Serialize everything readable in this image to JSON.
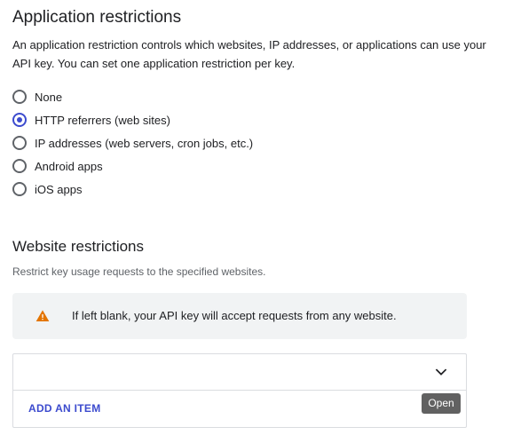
{
  "application_restrictions": {
    "title": "Application restrictions",
    "description": "An application restriction controls which websites, IP addresses, or applications can use your API key. You can set one application restriction per key.",
    "options": [
      {
        "label": "None",
        "checked": false
      },
      {
        "label": "HTTP referrers (web sites)",
        "checked": true
      },
      {
        "label": "IP addresses (web servers, cron jobs, etc.)",
        "checked": false
      },
      {
        "label": "Android apps",
        "checked": false
      },
      {
        "label": "iOS apps",
        "checked": false
      }
    ]
  },
  "website_restrictions": {
    "title": "Website restrictions",
    "subtitle": "Restrict key usage requests to the specified websites.",
    "warning": {
      "icon": "warning-icon",
      "text": "If left blank, your API key will accept requests from any website."
    },
    "item_list": {
      "expand_icon": "chevron-down-icon",
      "add_item_label": "ADD AN ITEM"
    },
    "tooltip": "Open"
  },
  "colors": {
    "accent": "#3c4bce",
    "warning": "#e37400",
    "panel_bg": "#f1f3f4",
    "tooltip_bg": "#616161"
  }
}
